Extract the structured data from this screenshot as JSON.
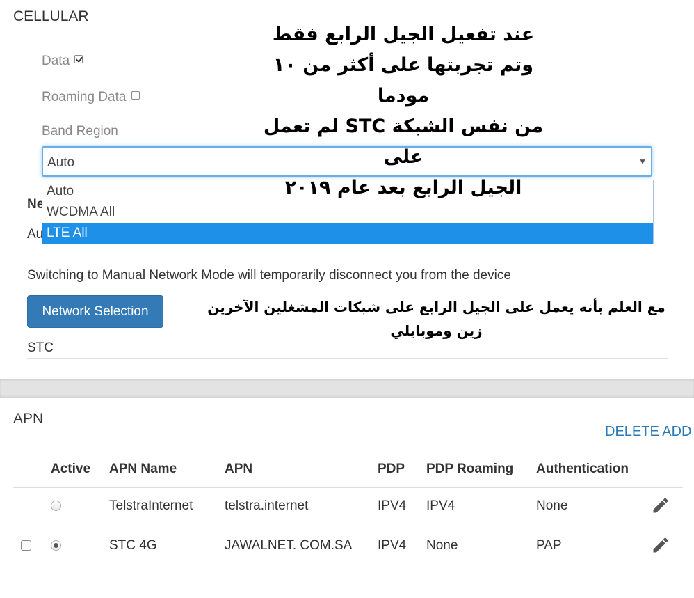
{
  "cellular": {
    "title": "CELLULAR",
    "data_label": "Data",
    "data_checked": true,
    "roaming_label": "Roaming Data",
    "roaming_checked": false,
    "band_region_label": "Band Region",
    "band_region_selected": "Auto",
    "band_region_options": [
      "Auto",
      "WCDMA All",
      "LTE All"
    ],
    "band_region_highlighted": "LTE All",
    "network_mode_title_partial": "Ne",
    "network_mode_value_partial": "Au",
    "switch_warning": "Switching to Manual Network Mode will temporarily disconnect you from the device",
    "network_selection_button": "Network Selection",
    "carrier": "STC"
  },
  "overlay": {
    "note_top": [
      "عند تفعيل الجيل الرابع فقط",
      "وتم تجربتها على أكثر من ١٠ مودما",
      "من نفس الشبكة STC لم تعمل على",
      "الجيل الرابع بعد عام ٢٠١٩"
    ],
    "note_bottom": [
      "مع العلم بأنه يعمل على الجيل الرابع على شبكات المشغلين الآخرين",
      "زين وموبايلي"
    ]
  },
  "apn": {
    "title": "APN",
    "delete_label": "DELETE",
    "add_label": "ADD",
    "columns": [
      "Active",
      "APN Name",
      "APN",
      "PDP",
      "PDP Roaming",
      "Authentication"
    ],
    "rows": [
      {
        "selectable": false,
        "active": false,
        "name": "TelstraInternet",
        "apn": "telstra.internet",
        "pdp": "IPV4",
        "pdp_roaming": "IPV4",
        "auth": "None"
      },
      {
        "selectable": true,
        "active": true,
        "name": "STC 4G",
        "apn": "JAWALNET. COM.SA",
        "pdp": "IPV4",
        "pdp_roaming": "None",
        "auth": "PAP"
      }
    ],
    "edit_icon": "pencil-icon"
  }
}
